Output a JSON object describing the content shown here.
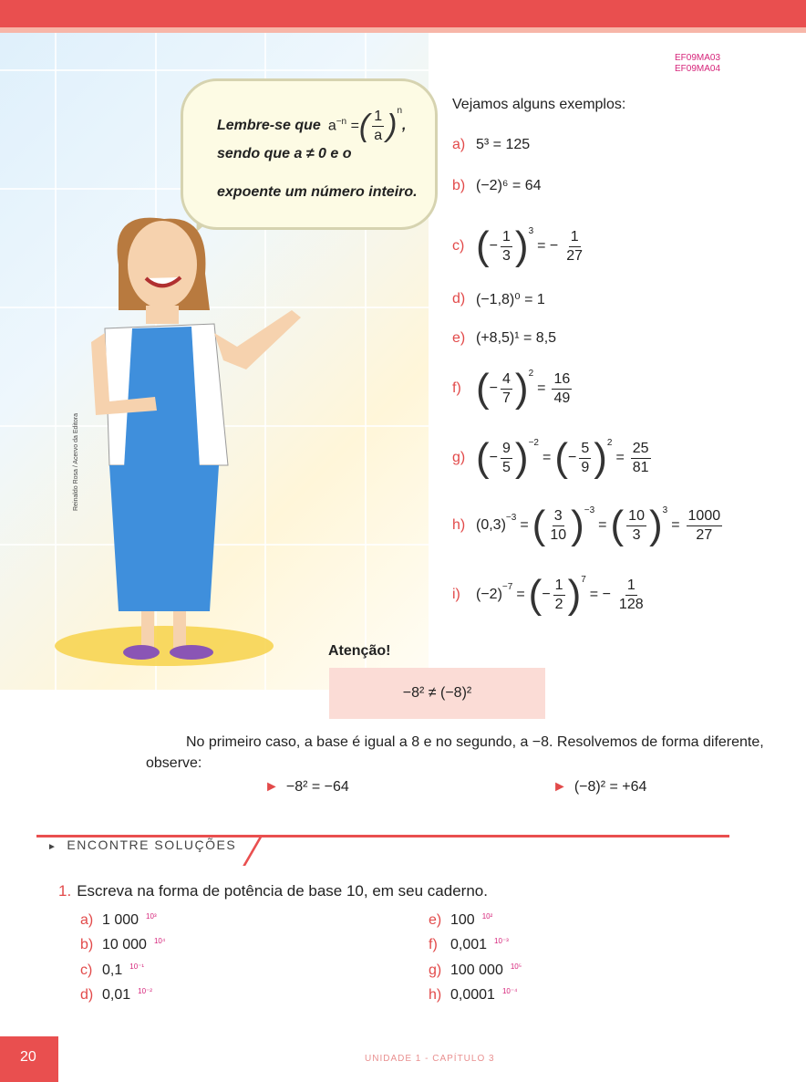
{
  "page": {
    "codes": [
      "EF09MA03",
      "EF09MA04"
    ],
    "number": "20",
    "footer": "UNIDADE 1  -  CAPÍTULO 3",
    "credit": "Reinaldo Rosa / Acervo da Editora"
  },
  "bubble": {
    "line1_prefix": "Lembre-se que",
    "formula_lhs": "a",
    "formula_exp": "−n",
    "formula_num": "1",
    "formula_den": "a",
    "formula_rexp": "n",
    "line2": "sendo que a ≠ 0 e o",
    "line3": "expoente um número inteiro."
  },
  "examples": {
    "intro": "Vejamos alguns exemplos:",
    "a": {
      "label": "a)",
      "text": "5³ = 125"
    },
    "b": {
      "label": "b)",
      "text": "(−2)⁶ = 64"
    },
    "c": {
      "label": "c)"
    },
    "d": {
      "label": "d)",
      "text": "(−1,8)⁰ = 1"
    },
    "e": {
      "label": "e)",
      "text": "(+8,5)¹ = 8,5"
    },
    "f": {
      "label": "f)"
    },
    "g": {
      "label": "g)"
    },
    "h": {
      "label": "h)"
    },
    "i": {
      "label": "i)"
    }
  },
  "attention": {
    "title": "Atenção!",
    "box": "−8² ≠ (−8)²"
  },
  "paragraph": "No primeiro caso, a base é igual a 8 e no segundo, a −8. Resolvemos de forma diferente, observe:",
  "bullets": [
    "−8² = −64",
    "(−8)² = +64"
  ],
  "section": {
    "title": "ENCONTRE SOLUÇÕES"
  },
  "question": {
    "number": "1.",
    "text": "Escreva na forma de potência de base 10, em seu caderno.",
    "items": [
      {
        "label": "a)",
        "value": "1 000",
        "answer": "10³"
      },
      {
        "label": "b)",
        "value": "10 000",
        "answer": "10⁴"
      },
      {
        "label": "c)",
        "value": "0,1",
        "answer": "10⁻¹"
      },
      {
        "label": "d)",
        "value": "0,01",
        "answer": "10⁻²"
      },
      {
        "label": "e)",
        "value": "100",
        "answer": "10²"
      },
      {
        "label": "f)",
        "value": "0,001",
        "answer": "10⁻³"
      },
      {
        "label": "g)",
        "value": "100 000",
        "answer": "10⁵"
      },
      {
        "label": "h)",
        "value": "0,0001",
        "answer": "10⁻⁴"
      }
    ]
  }
}
